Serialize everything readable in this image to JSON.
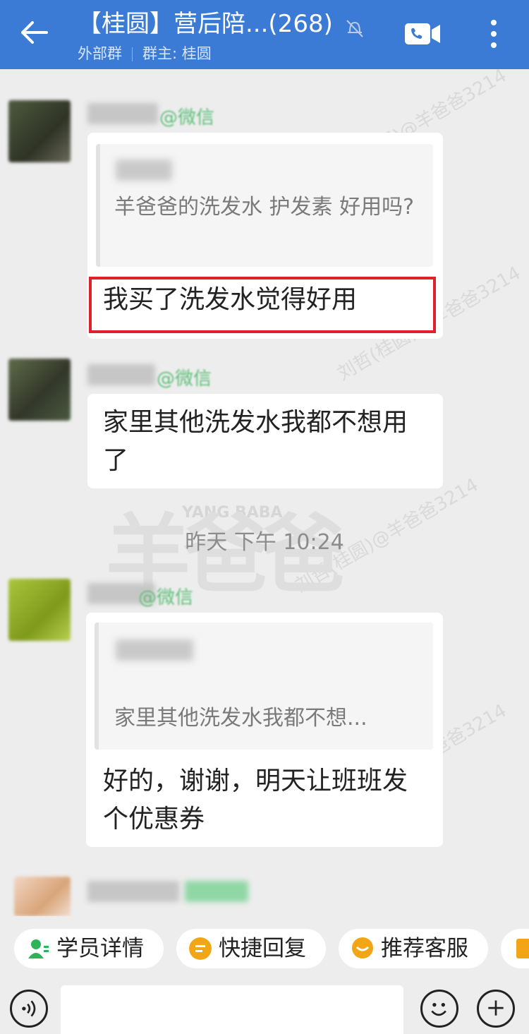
{
  "header": {
    "title": "【桂圆】营后陪...(268)",
    "subtitle_prefix": "外部群",
    "subtitle_owner": "群主: 桂圆"
  },
  "chat": {
    "messages": [
      {
        "quote": {
          "text": "羊爸爸的洗发水 护发素 好用吗?"
        },
        "text": "我买了洗发水觉得好用"
      },
      {
        "text": "家里其他洗发水我都不想用了"
      },
      {
        "quote": {
          "text": "家里其他洗发水我都不想..."
        },
        "text": "好的，谢谢，明天让班班发个优惠券"
      }
    ],
    "timestamp": "昨天 下午 10:24",
    "nick_tag": "@微信",
    "watermark_name": "刘哲(桂圆)@羊爸爸3214",
    "watermark_brand": "羊爸爸",
    "watermark_brand_en": "YANG BABA"
  },
  "quick_actions": [
    {
      "label": "学员详情",
      "color": "#2fb35a"
    },
    {
      "label": "快捷回复",
      "color": "#f2a515"
    },
    {
      "label": "推荐客服",
      "color": "#f2a515"
    }
  ],
  "colors": {
    "header_bg": "#3b7bd6",
    "highlight": "#e0202a",
    "chat_bg": "#ededed"
  },
  "icons": {
    "back": "back-arrow-icon",
    "mute": "mute-bell-icon",
    "video": "video-call-icon",
    "more": "more-vertical-icon",
    "voice": "voice-icon",
    "emoji": "emoji-icon",
    "plus": "plus-icon"
  }
}
